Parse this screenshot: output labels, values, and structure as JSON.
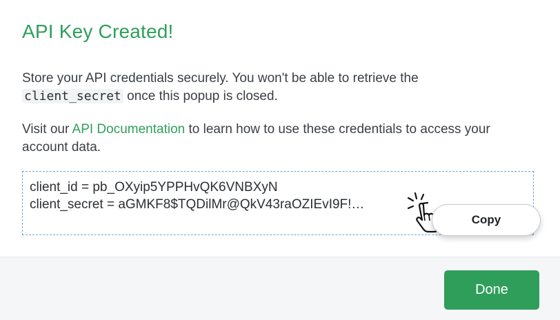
{
  "dialog": {
    "title": "API Key Created!",
    "para1_before": "Store your API credentials securely. You won't be able to retrieve the",
    "para1_code": "client_secret",
    "para1_after": " once this popup is closed.",
    "para2_before": "Visit our ",
    "para2_link": "API Documentation",
    "para2_after": " to learn how to use these credentials to access your account data.",
    "credentials": {
      "client_id_line": "client_id = pb_OXyip5YPPHvQK6VNBXyN",
      "client_secret_line": "client_secret = aGMKF8$TQDilMr@QkV43raOZIEvI9F!…"
    },
    "copy_label": "Copy",
    "done_label": "Done"
  },
  "icons": {
    "cursor": "hand-pointer-icon"
  },
  "colors": {
    "accent": "#2f9e5b",
    "box_border": "#6aa6d6"
  }
}
